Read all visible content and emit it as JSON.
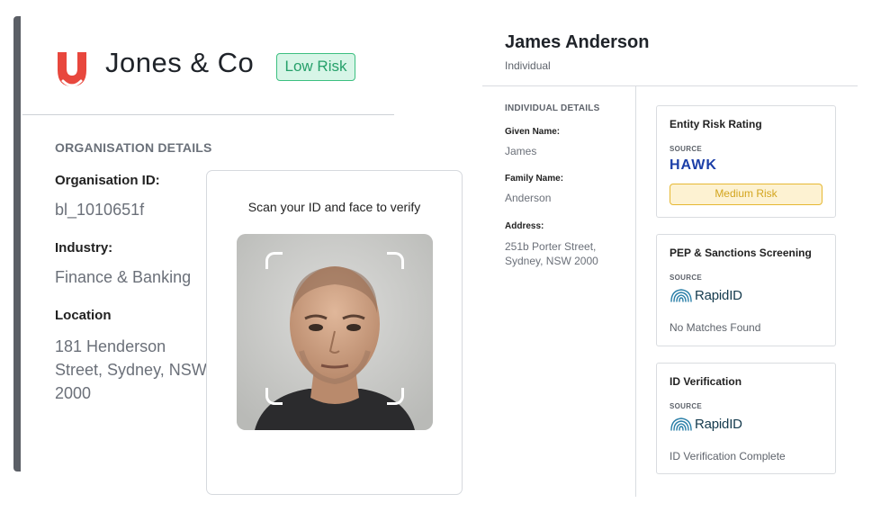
{
  "org": {
    "name": "Jones & Co",
    "risk_badge": "Low Risk",
    "section_heading": "ORGANISATION DETAILS",
    "id_label": "Organisation ID:",
    "id_value": "bl_1010651f",
    "industry_label": "Industry:",
    "industry_value": "Finance & Banking",
    "location_label": "Location",
    "location_value": "181 Henderson Street, Sydney, NSW 2000"
  },
  "verify": {
    "prompt": "Scan your ID and face to verify"
  },
  "person": {
    "name": "James Anderson",
    "type": "Individual",
    "section_heading": "INDIVIDUAL DETAILS",
    "given_label": "Given Name:",
    "given_value": "James",
    "family_label": "Family Name:",
    "family_value": "Anderson",
    "address_label": "Address:",
    "address_value": "251b Porter Street, Sydney, NSW 2000"
  },
  "cards": {
    "entity": {
      "title": "Entity Risk Rating",
      "source_label": "SOURCE",
      "source_name": "HAWK",
      "status": "Medium Risk"
    },
    "pep": {
      "title": "PEP & Sanctions Screening",
      "source_label": "SOURCE",
      "source_name": "RapidID",
      "status": "No Matches Found"
    },
    "idv": {
      "title": "ID Verification",
      "source_label": "SOURCE",
      "source_name": "RapidID",
      "status": "ID Verification Complete"
    }
  },
  "icons": {
    "brand_logo": "brand-logo-icon",
    "scan_frame": "scan-frame-icon",
    "rapidid_logo": "fingerprint-icon"
  },
  "colors": {
    "brand_red": "#e8473d",
    "low_risk_green": "#26a06a",
    "medium_risk_amber": "#d3a51f",
    "hawk_blue": "#1c3fa8"
  }
}
